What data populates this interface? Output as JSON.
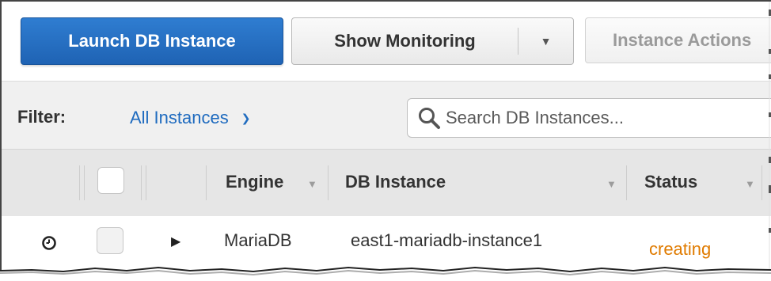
{
  "toolbar": {
    "launch_label": "Launch DB Instance",
    "monitor_label": "Show Monitoring",
    "actions_label": "Instance Actions"
  },
  "filter": {
    "label": "Filter:",
    "value": "All Instances"
  },
  "search": {
    "placeholder": "Search DB Instances..."
  },
  "table": {
    "headers": {
      "engine": "Engine",
      "db_instance": "DB Instance",
      "status": "Status"
    },
    "rows": [
      {
        "engine": "MariaDB",
        "db_instance": "east1-mariadb-instance1",
        "status": "creating"
      }
    ]
  },
  "colors": {
    "primary": "#1f6bbf",
    "status_creating": "#e07b00"
  }
}
